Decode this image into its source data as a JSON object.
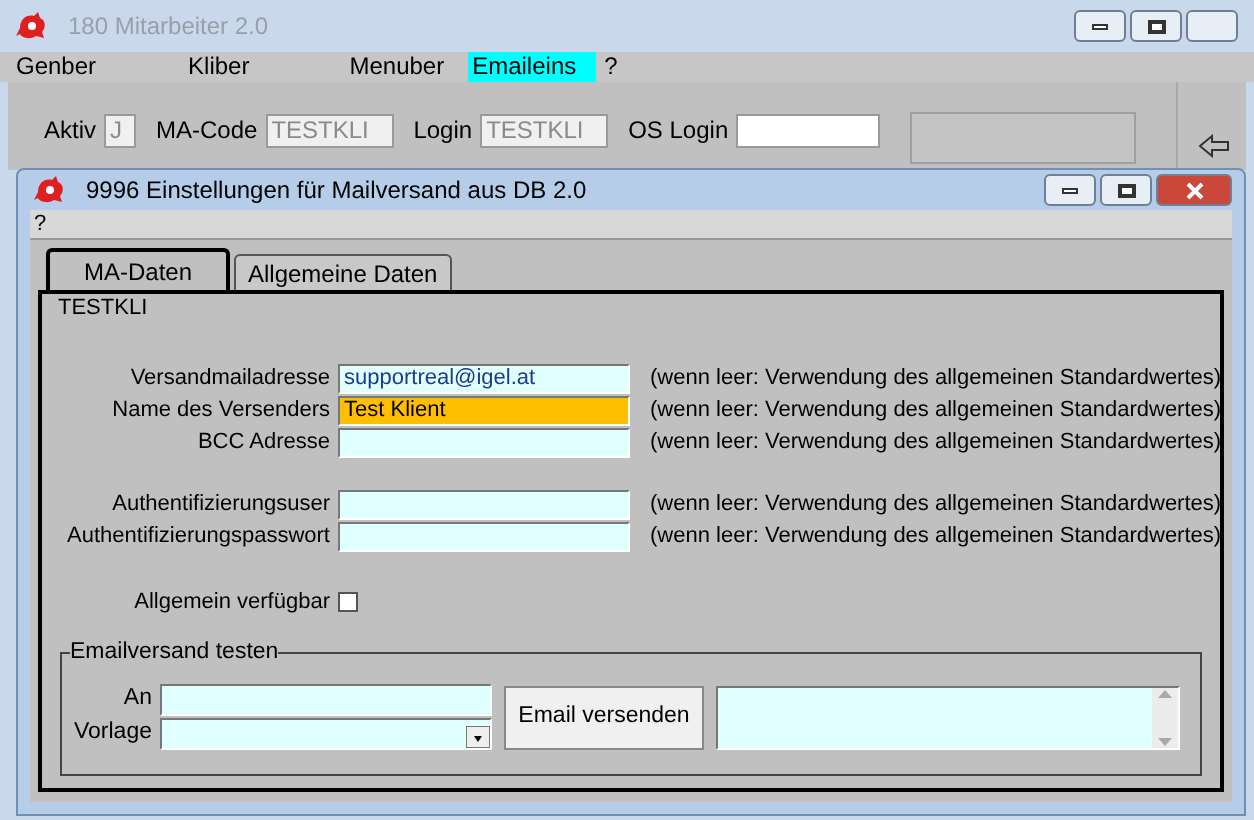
{
  "main_window": {
    "title": "180 Mitarbeiter 2.0"
  },
  "menu": [
    {
      "label": "Genber",
      "selected": false
    },
    {
      "label": "Kliber",
      "selected": false
    },
    {
      "label": "Menuber",
      "selected": false
    },
    {
      "label": "Emaileins",
      "selected": true
    },
    {
      "label": "?",
      "selected": false
    }
  ],
  "header_fields": [
    {
      "label": "Aktiv",
      "value": "J",
      "kind": "short",
      "disabled": true
    },
    {
      "label": "MA-Code",
      "value": "TESTKLI",
      "kind": "normal",
      "disabled": true
    },
    {
      "label": "Login",
      "value": "TESTKLI",
      "kind": "normal",
      "disabled": true
    },
    {
      "label": "OS Login",
      "kind": "wide",
      "disabled": false
    }
  ],
  "dialog": {
    "title": "9996 Einstellungen für Mailversand aus DB 2.0",
    "menu": [
      "?"
    ],
    "tabs": [
      {
        "label": "MA-Daten",
        "selected": true
      },
      {
        "label": "Allgemeine Daten",
        "selected": false
      }
    ],
    "record": "TESTKLI",
    "field_groups": [
      [
        {
          "label": "Versandmailadresse",
          "value": "supportreal@igel.at",
          "focused": false,
          "hint": "(wenn leer: Verwendung des allgemeinen Standardwertes)"
        },
        {
          "label": "Name des Versenders",
          "value": "Test Klient",
          "focused": true,
          "hint": "(wenn leer: Verwendung des allgemeinen Standardwertes)"
        },
        {
          "label": "BCC Adresse",
          "focused": false,
          "hint": "(wenn leer: Verwendung des allgemeinen Standardwertes)"
        }
      ],
      [
        {
          "label": "Authentifizierungsuser",
          "focused": false,
          "hint": "(wenn leer: Verwendung des allgemeinen Standardwertes)"
        },
        {
          "label": "Authentifizierungspasswort",
          "focused": false,
          "hint": "(wenn leer: Verwendung des allgemeinen Standardwertes)"
        }
      ]
    ],
    "checkbox": {
      "label": "Allgemein verfügbar",
      "checked": false
    },
    "test_group": {
      "title": "Emailversand testen",
      "to_label": "An",
      "template_label": "Vorlage",
      "send_button": "Email versenden"
    }
  }
}
